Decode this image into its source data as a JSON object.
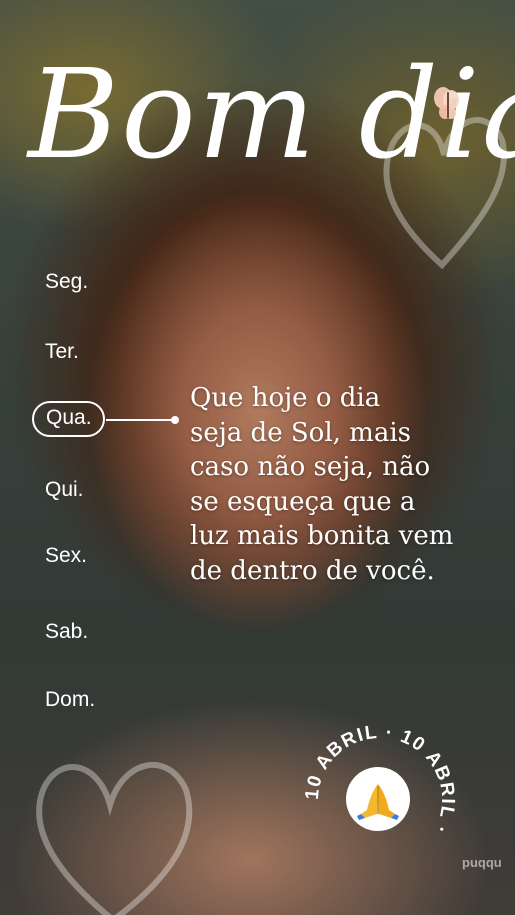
{
  "title": "Bom dia",
  "days": [
    {
      "label": "Seg.",
      "active": false
    },
    {
      "label": "Ter.",
      "active": false
    },
    {
      "label": "Qua.",
      "active": true
    },
    {
      "label": "Qui.",
      "active": false
    },
    {
      "label": "Sex.",
      "active": false
    },
    {
      "label": "Sab.",
      "active": false
    },
    {
      "label": "Dom.",
      "active": false
    }
  ],
  "quote_lines": [
    "Que hoje o dia",
    "seja de Sol, mais",
    "caso não seja, não",
    "se esqueça que a",
    "luz mais bonita vem",
    "de dentro de você."
  ],
  "badge": {
    "text": "10 ABRIL · 10 ABRIL · ",
    "icon": "praying-hands-icon"
  },
  "watermark": "puqqu",
  "colors": {
    "text": "#ffffff",
    "butterfly": "#f5c9b3"
  }
}
